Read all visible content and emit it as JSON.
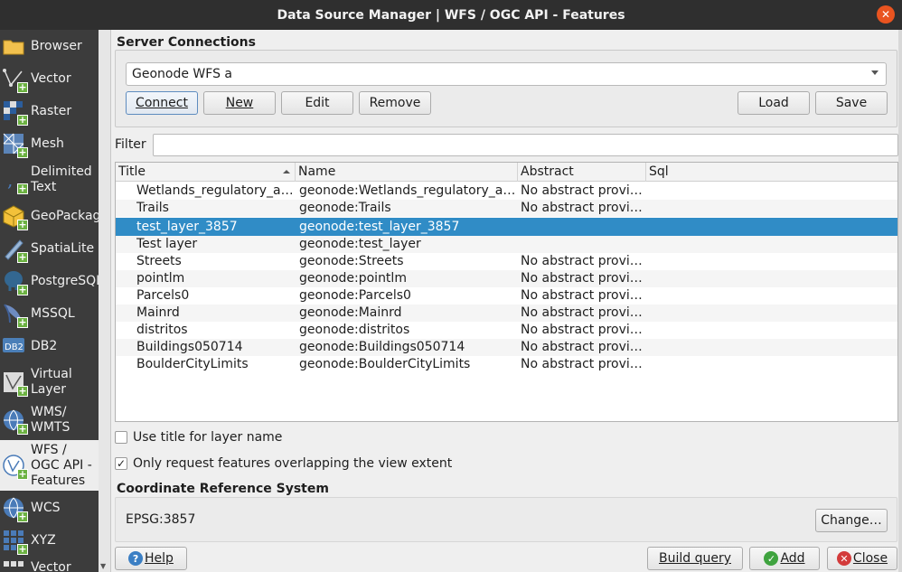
{
  "window": {
    "title": "Data Source Manager | WFS / OGC API - Features"
  },
  "sidebar": {
    "items": [
      {
        "label": "Browser",
        "icon": "folder-icon"
      },
      {
        "label": "Vector",
        "icon": "vector-icon"
      },
      {
        "label": "Raster",
        "icon": "raster-icon"
      },
      {
        "label": "Mesh",
        "icon": "mesh-icon"
      },
      {
        "label": "Delimited Text",
        "icon": "delimited-text-icon"
      },
      {
        "label": "GeoPackage",
        "icon": "geopackage-icon"
      },
      {
        "label": "SpatiaLite",
        "icon": "spatialite-icon"
      },
      {
        "label": "PostgreSQL",
        "icon": "postgresql-icon"
      },
      {
        "label": "MSSQL",
        "icon": "mssql-icon"
      },
      {
        "label": "DB2",
        "icon": "db2-icon"
      },
      {
        "label": "Virtual Layer",
        "icon": "virtual-layer-icon"
      },
      {
        "label": "WMS/ WMTS",
        "icon": "wms-icon"
      },
      {
        "label": "WFS / OGC API - Features",
        "icon": "wfs-icon"
      },
      {
        "label": "WCS",
        "icon": "wcs-icon"
      },
      {
        "label": "XYZ",
        "icon": "xyz-icon"
      },
      {
        "label": "Vector",
        "icon": "vector-tile-icon"
      }
    ]
  },
  "connections": {
    "title": "Server Connections",
    "selected": "Geonode WFS a",
    "buttons": {
      "connect": "Connect",
      "new": "New",
      "edit": "Edit",
      "remove": "Remove",
      "load": "Load",
      "save": "Save"
    }
  },
  "filter": {
    "label": "Filter",
    "value": ""
  },
  "table": {
    "columns": [
      "Title",
      "Name",
      "Abstract",
      "Sql"
    ],
    "rows": [
      {
        "title": "Wetlands_regulatory_a…",
        "name": "geonode:Wetlands_regulatory_a…",
        "abstract": "No abstract provi…",
        "sql": ""
      },
      {
        "title": "Trails",
        "name": "geonode:Trails",
        "abstract": "No abstract provi…",
        "sql": ""
      },
      {
        "title": "test_layer_3857",
        "name": "geonode:test_layer_3857",
        "abstract": "",
        "sql": ""
      },
      {
        "title": "Test layer",
        "name": "geonode:test_layer",
        "abstract": "",
        "sql": ""
      },
      {
        "title": "Streets",
        "name": "geonode:Streets",
        "abstract": "No abstract provi…",
        "sql": ""
      },
      {
        "title": "pointlm",
        "name": "geonode:pointlm",
        "abstract": "No abstract provi…",
        "sql": ""
      },
      {
        "title": "Parcels0",
        "name": "geonode:Parcels0",
        "abstract": "No abstract provi…",
        "sql": ""
      },
      {
        "title": "Mainrd",
        "name": "geonode:Mainrd",
        "abstract": "No abstract provi…",
        "sql": ""
      },
      {
        "title": "distritos",
        "name": "geonode:distritos",
        "abstract": "No abstract provi…",
        "sql": ""
      },
      {
        "title": "Buildings050714",
        "name": "geonode:Buildings050714",
        "abstract": "No abstract provi…",
        "sql": ""
      },
      {
        "title": "BoulderCityLimits",
        "name": "geonode:BoulderCityLimits",
        "abstract": "No abstract provi…",
        "sql": ""
      }
    ]
  },
  "options": {
    "use_title": {
      "label": "Use title for layer name",
      "checked": false
    },
    "only_request": {
      "label": "Only request features overlapping the view extent",
      "checked": true,
      "mark": "✓"
    }
  },
  "crs": {
    "title": "Coordinate Reference System",
    "value": "EPSG:3857",
    "change_label": "Change…"
  },
  "footer": {
    "help": "Help",
    "build_query": "Build query",
    "add": "Add",
    "close": "Close"
  }
}
